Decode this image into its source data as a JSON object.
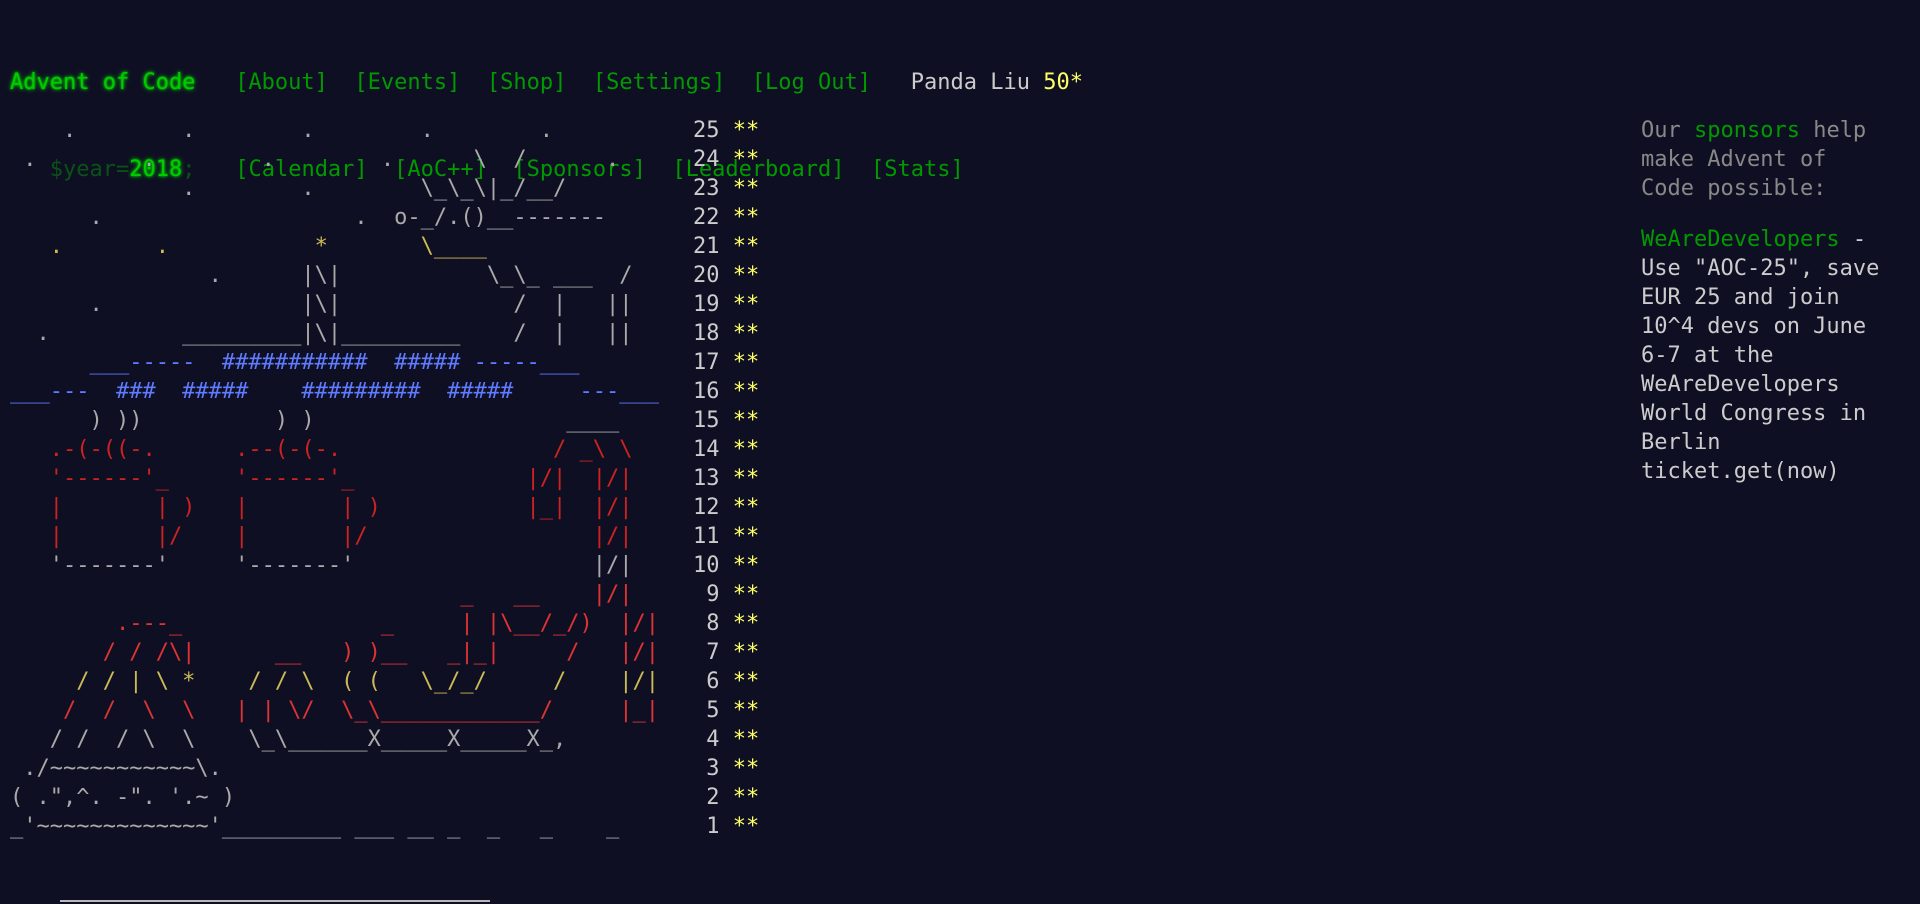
{
  "header": {
    "title": "Advent of Code",
    "nav_row1": [
      "[About]",
      "[Events]",
      "[Shop]",
      "[Settings]",
      "[Log Out]"
    ],
    "user": "Panda Liu",
    "user_stars": "50*",
    "year_prefix": "$year=",
    "year_value": "2018",
    "year_suffix": ";",
    "nav_row2": [
      "[Calendar]",
      "[AoC++]",
      "[Sponsors]",
      "[Leaderboard]",
      "[Stats]"
    ]
  },
  "calendar": {
    "stars": "**",
    "days": [
      {
        "day": "25",
        "art": "    .        .        .        .        .       "
      },
      {
        "day": "24",
        "art": " .        .        .        .      \\  /      .  "
      },
      {
        "day": "23",
        "art": "             .        .        \\_\\_\\|_/__/     "
      },
      {
        "day": "22",
        "art": "      .                   .  o-_/.()__------- "
      },
      {
        "day": "21",
        "art": "   .       .           *       \\____          "
      },
      {
        "day": "20",
        "art": "               .      |\\|           \\_\\_ ___  /"
      },
      {
        "day": "19",
        "art": "      .               |\\|             /  |   ||"
      },
      {
        "day": "18",
        "art": "  .          _________|\\|_________    /  |   ||"
      },
      {
        "day": "17",
        "art": "      ___-----  ###########  ##### -----___    "
      },
      {
        "day": "16",
        "art": "___---  ###  #####    #########  #####     ---___"
      },
      {
        "day": "15",
        "art": "      ) ))          ) )                   ____ "
      },
      {
        "day": "14",
        "art": "   .-(-((-.      .--(-(-.                / _\\ \\ "
      },
      {
        "day": "13",
        "art": "   '------'_     '------'_             |/|  |/|"
      },
      {
        "day": "12",
        "art": "   |       | )   |       | )           |_|  |/|"
      },
      {
        "day": "11",
        "art": "   |       |/    |       |/                 |/|"
      },
      {
        "day": "10",
        "art": "   '-------'     '-------'                  |/|"
      },
      {
        "day": "9",
        "art": "                                  _   __    |/|"
      },
      {
        "day": "8",
        "art": "        .---_               _     | |\\__/_/)  |/|"
      },
      {
        "day": "7",
        "art": "       / / /\\|      __   ) )__   _|_|     /   |/|"
      },
      {
        "day": "6",
        "art": "     / / | \\ *    / / \\  ( (   \\_/_/     /    |/|"
      },
      {
        "day": "5",
        "art": "    /  /  \\  \\   | | \\/  \\_\\____________/     |_|"
      },
      {
        "day": "4",
        "art": "   / /  / \\  \\    \\_\\______X_____X_____X_,      "
      },
      {
        "day": "3",
        "art": " ./~~~~~~~~~~~\\.                              "
      },
      {
        "day": "2",
        "art": "( .\",^. -\". '.~ )                              "
      },
      {
        "day": "1",
        "art": "_'~~~~~~~~~~~~~'_________ ___ __ _  _   _    _   "
      }
    ]
  },
  "sidebar": {
    "line1_pre": "Our ",
    "line1_link": "sponsors",
    "line1_post": " help make Advent of Code possible:",
    "sponsor_name": "WeAreDevelopers",
    "sponsor_text": " - Use \"AOC-25\", save EUR 25 and join 10^4 devs on June 6-7 at the WeAreDevelopers World Congress in Berlin ticket.get(now)"
  }
}
